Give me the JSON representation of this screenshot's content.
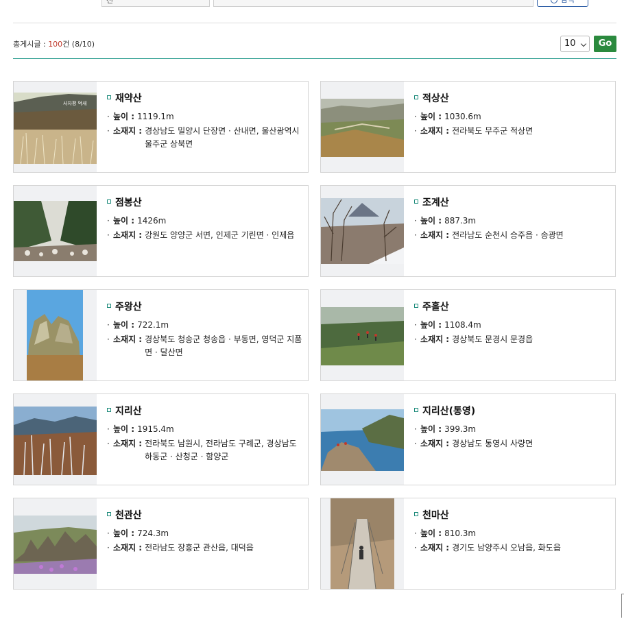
{
  "search": {
    "field_label": "전",
    "button_label": "검색"
  },
  "summary": {
    "prefix": "총게시글 : ",
    "count": "100",
    "suffix": "건 (8/10)"
  },
  "pager": {
    "per_page": "10",
    "go_label": "Go"
  },
  "labels": {
    "height": "높이 : ",
    "location": "소재지 : "
  },
  "mountains": [
    {
      "name": "재약산",
      "height": "1119.1m",
      "location": "경상남도 밀양시 단장면 · 산내면, 울산광역시 울주군 상북면",
      "photo_text": "사자평 억새"
    },
    {
      "name": "적상산",
      "height": "1030.6m",
      "location": "전라북도 무주군 적상면"
    },
    {
      "name": "점봉산",
      "height": "1426m",
      "location": "강원도 양양군 서면, 인제군 기린면 · 인제읍"
    },
    {
      "name": "조계산",
      "height": "887.3m",
      "location": "전라남도 순천시 승주읍 · 송광면"
    },
    {
      "name": "주왕산",
      "height": "722.1m",
      "location": "경상북도 청송군 청송읍 · 부동면, 영덕군 지품면 · 달산면"
    },
    {
      "name": "주흘산",
      "height": "1108.4m",
      "location": "경상북도 문경시 문경읍"
    },
    {
      "name": "지리산",
      "height": "1915.4m",
      "location": "전라북도 남원시, 전라남도 구례군, 경상남도 하동군 · 산청군 · 함양군"
    },
    {
      "name": "지리산(통영)",
      "height": "399.3m",
      "location": "경상남도 통영시 사량면"
    },
    {
      "name": "천관산",
      "height": "724.3m",
      "location": "전라남도 장흥군 관산읍, 대덕읍"
    },
    {
      "name": "천마산",
      "height": "810.3m",
      "location": "경기도 남양주시 오남읍, 화도읍"
    }
  ]
}
